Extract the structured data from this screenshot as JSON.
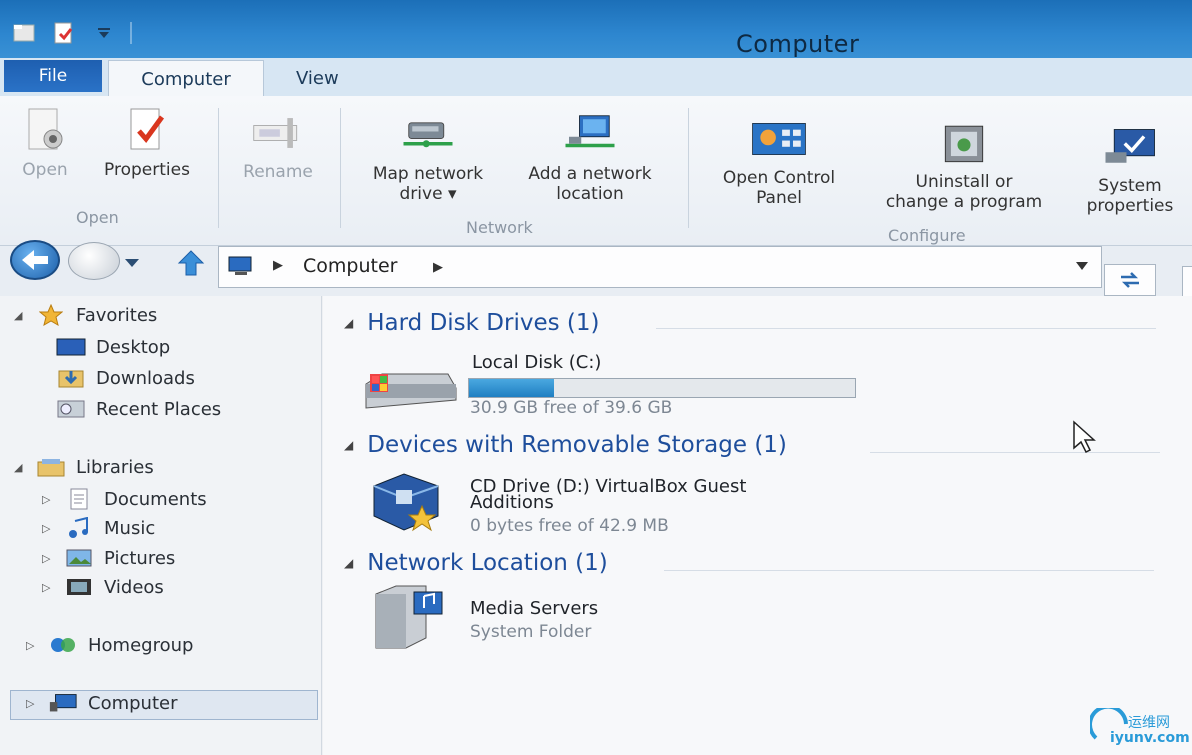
{
  "window": {
    "title": "Computer"
  },
  "ribbon": {
    "tabs": {
      "file": "File",
      "computer": "Computer",
      "view": "View"
    },
    "groups": {
      "open": "Open",
      "network": "Network",
      "configure": "Configure"
    },
    "buttons": {
      "open": "Open",
      "properties": "Properties",
      "rename": "Rename",
      "map_network_drive_1": "Map network",
      "map_network_drive_2": "drive ▾",
      "add_network_location_1": "Add a network",
      "add_network_location_2": "location",
      "open_control_panel_1": "Open Control",
      "open_control_panel_2": "Panel",
      "uninstall_1": "Uninstall or",
      "uninstall_2": "change a program",
      "system_properties_1": "System",
      "system_properties_2": "properties"
    }
  },
  "address": {
    "path": "Computer"
  },
  "nav": {
    "favorites": "Favorites",
    "desktop": "Desktop",
    "downloads": "Downloads",
    "recent_places": "Recent Places",
    "libraries": "Libraries",
    "documents": "Documents",
    "music": "Music",
    "pictures": "Pictures",
    "videos": "Videos",
    "homegroup": "Homegroup",
    "computer": "Computer"
  },
  "content": {
    "hdd_header": "Hard Disk Drives (1)",
    "local_disk": {
      "name": "Local Disk (C:)",
      "free": "30.9 GB free of 39.6 GB",
      "used_fraction": 0.22
    },
    "removable_header": "Devices with Removable Storage (1)",
    "cd_drive": {
      "name_1": "CD Drive (D:) VirtualBox Guest",
      "name_2": "Additions",
      "free": "0 bytes free of 42.9 MB"
    },
    "network_header": "Network Location (1)",
    "media_servers": {
      "name": "Media Servers",
      "type": "System Folder"
    }
  },
  "watermark": {
    "line1": "运维网",
    "line2": "iyunv.com"
  },
  "colors": {
    "accent": "#1e4e9c",
    "titlebar": "#2d86cf",
    "progress": "#1f7fc2"
  }
}
